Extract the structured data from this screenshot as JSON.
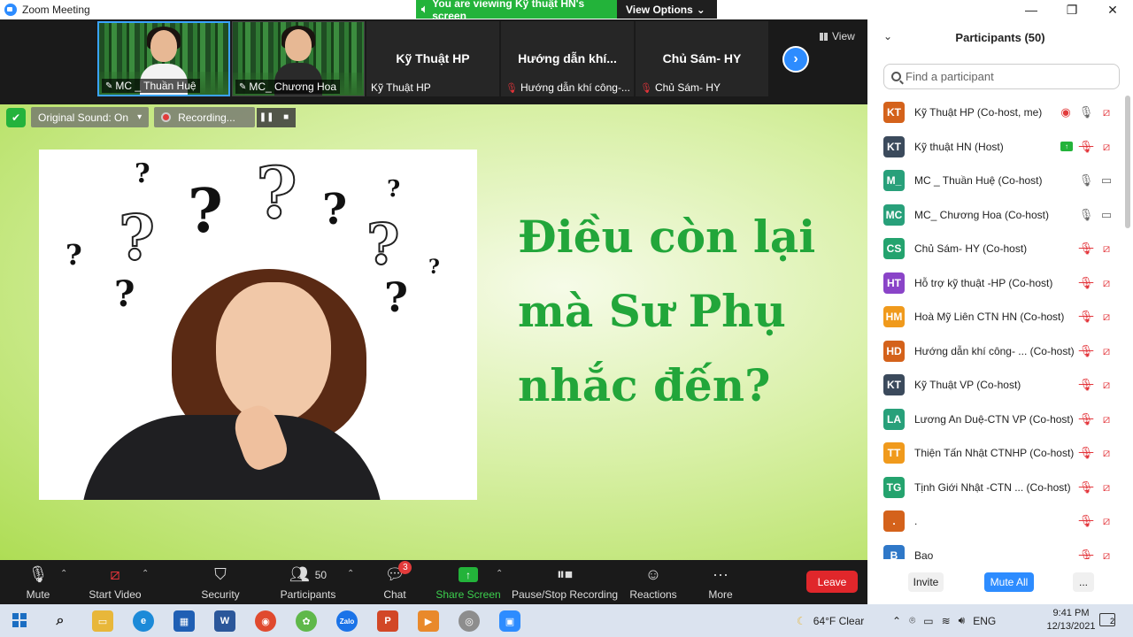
{
  "window": {
    "title": "Zoom Meeting",
    "minimize": "—",
    "maximize": "❐",
    "close": "✕"
  },
  "banner": {
    "viewing_text": "You are viewing Kỹ thuật HN's screen",
    "view_options": "View Options"
  },
  "thumbnails": [
    {
      "name": "MC _ Thuần Huệ"
    },
    {
      "name": "MC_ Chương Hoa"
    },
    {
      "center": "Kỹ Thuật HP",
      "label": "Kỹ Thuật HP"
    },
    {
      "center": "Hướng dẫn khí...",
      "label": "Hướng dẫn khí công-..."
    },
    {
      "center": "Chủ Sám- HY",
      "label": "Chủ Sám- HY"
    }
  ],
  "view_label": "View",
  "share_controls": {
    "original_sound": "Original Sound: On",
    "recording": "Recording..."
  },
  "slide": {
    "line1": "Điều còn lại",
    "line2": "mà Sư Phụ",
    "line3": "nhắc đến?"
  },
  "toolbar": {
    "mute": "Mute",
    "start_video": "Start Video",
    "security": "Security",
    "participants": "Participants",
    "participants_count": "50",
    "chat": "Chat",
    "chat_badge": "3",
    "share_screen": "Share Screen",
    "pause_stop": "Pause/Stop Recording",
    "reactions": "Reactions",
    "more": "More",
    "leave": "Leave"
  },
  "panel": {
    "title": "Participants (50)",
    "search_placeholder": "Find a participant",
    "invite": "Invite",
    "mute_all": "Mute All",
    "more": "...",
    "participants": [
      {
        "initials": "KT",
        "color": "#d4621b",
        "name": "Kỹ Thuật HP (Co-host, me)",
        "mic": "live",
        "cam": "off",
        "rec": true
      },
      {
        "initials": "KT",
        "color": "#3b4a5c",
        "name": "Kỹ thuật HN (Host)",
        "mic": "off",
        "cam": "off",
        "share": true
      },
      {
        "initials": "M_",
        "color": "#28a07a",
        "name": "MC _ Thuần Huệ (Co-host)",
        "mic": "live",
        "cam": "live"
      },
      {
        "initials": "MC",
        "color": "#28a07a",
        "name": "MC_ Chương Hoa (Co-host)",
        "mic": "live",
        "cam": "live"
      },
      {
        "initials": "CS",
        "color": "#24a36e",
        "name": "Chủ Sám- HY (Co-host)",
        "mic": "off",
        "cam": "off"
      },
      {
        "initials": "HT",
        "color": "#8a44c8",
        "name": "Hỗ trợ kỹ thuật -HP (Co-host)",
        "mic": "off",
        "cam": "off"
      },
      {
        "initials": "HM",
        "color": "#f09a1c",
        "name": "Hoà Mỹ Liên CTN HN (Co-host)",
        "mic": "off",
        "cam": "off"
      },
      {
        "initials": "HD",
        "color": "#d4621b",
        "name": "Hướng dẫn khí công- ... (Co-host)",
        "mic": "off",
        "cam": "off"
      },
      {
        "initials": "KT",
        "color": "#3b4a5c",
        "name": "Kỹ Thuật VP (Co-host)",
        "mic": "off",
        "cam": "off"
      },
      {
        "initials": "LA",
        "color": "#28a07a",
        "name": "Lương An Duệ-CTN VP (Co-host)",
        "mic": "off",
        "cam": "off"
      },
      {
        "initials": "TT",
        "color": "#f09a1c",
        "name": "Thiện Tấn Nhật CTNHP (Co-host)",
        "mic": "off",
        "cam": "off"
      },
      {
        "initials": "TG",
        "color": "#24a36e",
        "name": "Tịnh Giới Nhật -CTN ...  (Co-host)",
        "mic": "off",
        "cam": "off"
      },
      {
        "initials": ".",
        "color": "#d4621b",
        "name": ".",
        "mic": "off",
        "cam": "off"
      },
      {
        "initials": "B",
        "color": "#2f78c8",
        "name": "Bao",
        "mic": "off",
        "cam": "off"
      }
    ]
  },
  "taskbar": {
    "weather": "64°F  Clear",
    "lang": "ENG",
    "time": "9:41 PM",
    "date": "12/13/2021",
    "notif_count": "2"
  }
}
